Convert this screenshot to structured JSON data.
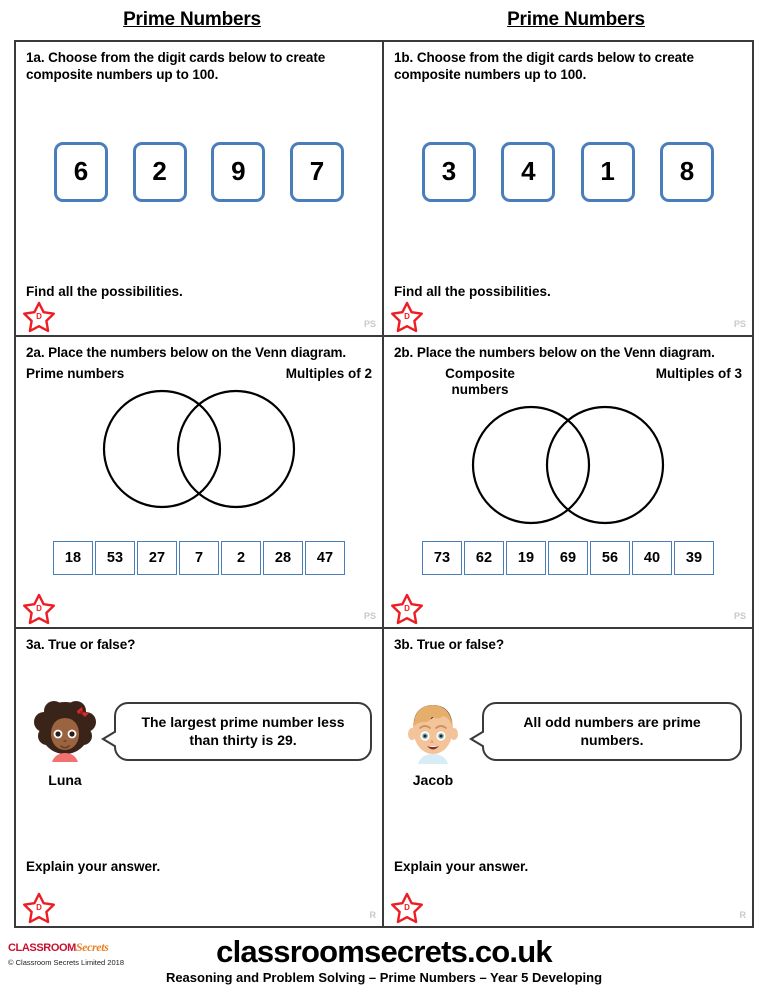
{
  "titles": {
    "left": "Prime Numbers",
    "right": "Prime Numbers"
  },
  "colors": {
    "card_border": "#4a7ebb",
    "tile_border": "#4a7ebb",
    "star": "#ee1c23",
    "panel_border": "#3a3a3a",
    "code_mark": "#c9c9c9",
    "logo_red": "#c8102e",
    "logo_orange": "#e8822a"
  },
  "questions": {
    "q1a": {
      "prompt": "1a. Choose from the digit cards below to create composite numbers up to 100.",
      "cards": [
        "6",
        "2",
        "9",
        "7"
      ],
      "instruction": "Find all the possibilities.",
      "badge": "D",
      "code": "PS"
    },
    "q1b": {
      "prompt": "1b. Choose from the digit cards below to create composite numbers up to 100.",
      "cards": [
        "3",
        "4",
        "1",
        "8"
      ],
      "instruction": "Find all the possibilities.",
      "badge": "D",
      "code": "PS"
    },
    "q2a": {
      "prompt": "2a. Place the numbers below on the Venn diagram.",
      "left_label": "Prime numbers",
      "right_label": "Multiples of 2",
      "numbers": [
        "18",
        "53",
        "27",
        "7",
        "2",
        "28",
        "47"
      ],
      "badge": "D",
      "code": "PS"
    },
    "q2b": {
      "prompt": "2b. Place the numbers below on the Venn diagram.",
      "left_label": "Composite numbers",
      "right_label": "Multiples of 3",
      "numbers": [
        "73",
        "62",
        "19",
        "69",
        "56",
        "40",
        "39"
      ],
      "badge": "D",
      "code": "PS"
    },
    "q3a": {
      "prompt": "3a. True or false?",
      "character_name": "Luna",
      "speech": "The largest prime number less than thirty is 29.",
      "instruction": "Explain your answer.",
      "badge": "D",
      "code": "R"
    },
    "q3b": {
      "prompt": "3b. True or false?",
      "character_name": "Jacob",
      "speech": "All odd numbers are prime numbers.",
      "instruction": "Explain your answer.",
      "badge": "D",
      "code": "R"
    }
  },
  "footer": {
    "logo_word_1": "CLASSROOM",
    "logo_word_2": "Secrets",
    "copyright": "© Classroom Secrets Limited 2018",
    "brand": "classroomsecrets.co.uk",
    "subline": "Reasoning and Problem Solving – Prime Numbers – Year 5 Developing"
  }
}
